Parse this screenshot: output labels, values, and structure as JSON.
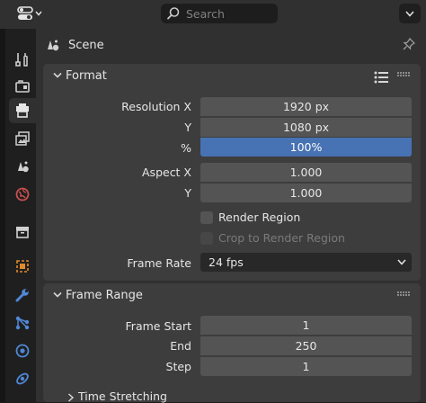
{
  "header": {
    "search_placeholder": "Search"
  },
  "context": {
    "label": "Scene"
  },
  "format": {
    "title": "Format",
    "resolution_x_label": "Resolution X",
    "resolution_x": "1920 px",
    "resolution_y_label": "Y",
    "resolution_y": "1080 px",
    "percent_label": "%",
    "percent": "100%",
    "aspect_x_label": "Aspect X",
    "aspect_x": "1.000",
    "aspect_y_label": "Y",
    "aspect_y": "1.000",
    "render_region_label": "Render Region",
    "crop_label": "Crop to Render Region",
    "frame_rate_label": "Frame Rate",
    "frame_rate": "24 fps"
  },
  "frame_range": {
    "title": "Frame Range",
    "start_label": "Frame Start",
    "start": "1",
    "end_label": "End",
    "end": "250",
    "step_label": "Step",
    "step": "1",
    "sub_title": "Time Stretching"
  },
  "colors": {
    "accent_blue": "#4772b3",
    "panel_bg": "#303030",
    "section_bg": "#3d3d3d",
    "field_bg": "#545454"
  }
}
